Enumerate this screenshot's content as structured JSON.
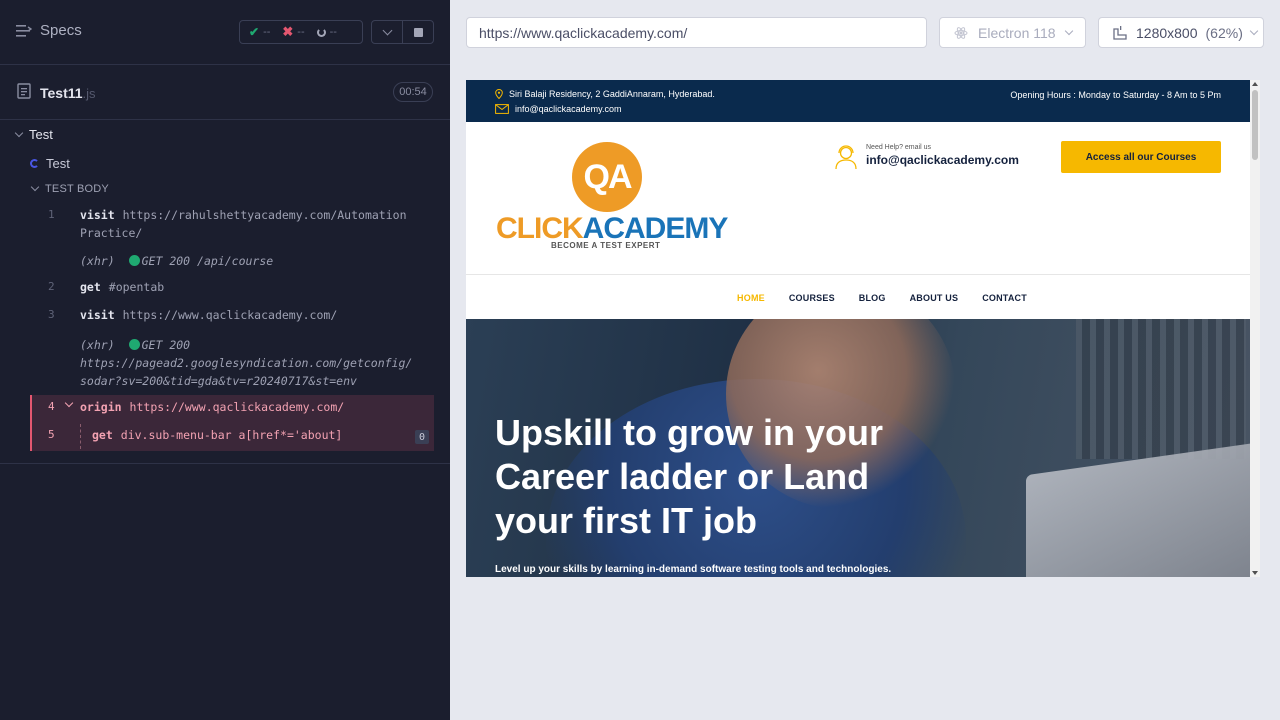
{
  "runner": {
    "specs_label": "Specs",
    "stats": {
      "passed": "--",
      "failed": "--",
      "pending": "--"
    },
    "file": {
      "name": "Test11",
      "ext": ".js",
      "duration": "00:54"
    },
    "suite": "Test",
    "test": "Test",
    "section": "TEST BODY",
    "commands": [
      {
        "num": "1",
        "name": "visit",
        "arg": "https://rahulshettyacademy.com/Automation",
        "arg2": "Practice/"
      },
      {
        "type": "(xhr)",
        "method": "GET 200",
        "path": "/api/course"
      },
      {
        "num": "2",
        "name": "get",
        "arg": "#opentab"
      },
      {
        "num": "3",
        "name": "visit",
        "arg": "https://www.qaclickacademy.com/"
      },
      {
        "type": "(xhr)",
        "method": "GET 200",
        "path": "https://pagead2.googlesyndication.com/getconfig/",
        "path2": "sodar?sv=200&tid=gda&tv=r20240717&st=env"
      },
      {
        "num": "4",
        "name": "origin",
        "arg": "https://www.qaclickacademy.com/"
      },
      {
        "num": "5",
        "name": "get",
        "arg": "div.sub-menu-bar a[href*='about]",
        "count": "0"
      }
    ]
  },
  "browser": {
    "url": "https://www.qaclickacademy.com/",
    "engine": "Electron 118",
    "viewport": "1280x800",
    "zoom": "(62%)"
  },
  "site": {
    "address": "Siri Balaji Residency, 2 GaddiAnnaram, Hyderabad.",
    "email_top": "info@qaclickacademy.com",
    "hours": "Opening Hours : Monday to Saturday - 8 Am to 5 Pm",
    "logo_qa": "QA",
    "logo_click": "CLICK",
    "logo_academy": "ACADEMY",
    "logo_tagline": "BECOME A TEST EXPERT",
    "help_label": "Need Help? email us",
    "help_email": "info@qaclickacademy.com",
    "cta": "Access all our Courses",
    "nav": [
      "HOME",
      "COURSES",
      "BLOG",
      "ABOUT US",
      "CONTACT"
    ],
    "hero_title": "Upskill to grow in your Career ladder or Land your first IT job",
    "hero_sub": "Level up your skills by learning in-demand software testing tools and technologies."
  },
  "colors": {
    "runner_bg": "#1b1e2e",
    "pass": "#1fa971",
    "fail": "#e45770",
    "site_dark": "#0a2a4d",
    "cta": "#f6b800"
  }
}
